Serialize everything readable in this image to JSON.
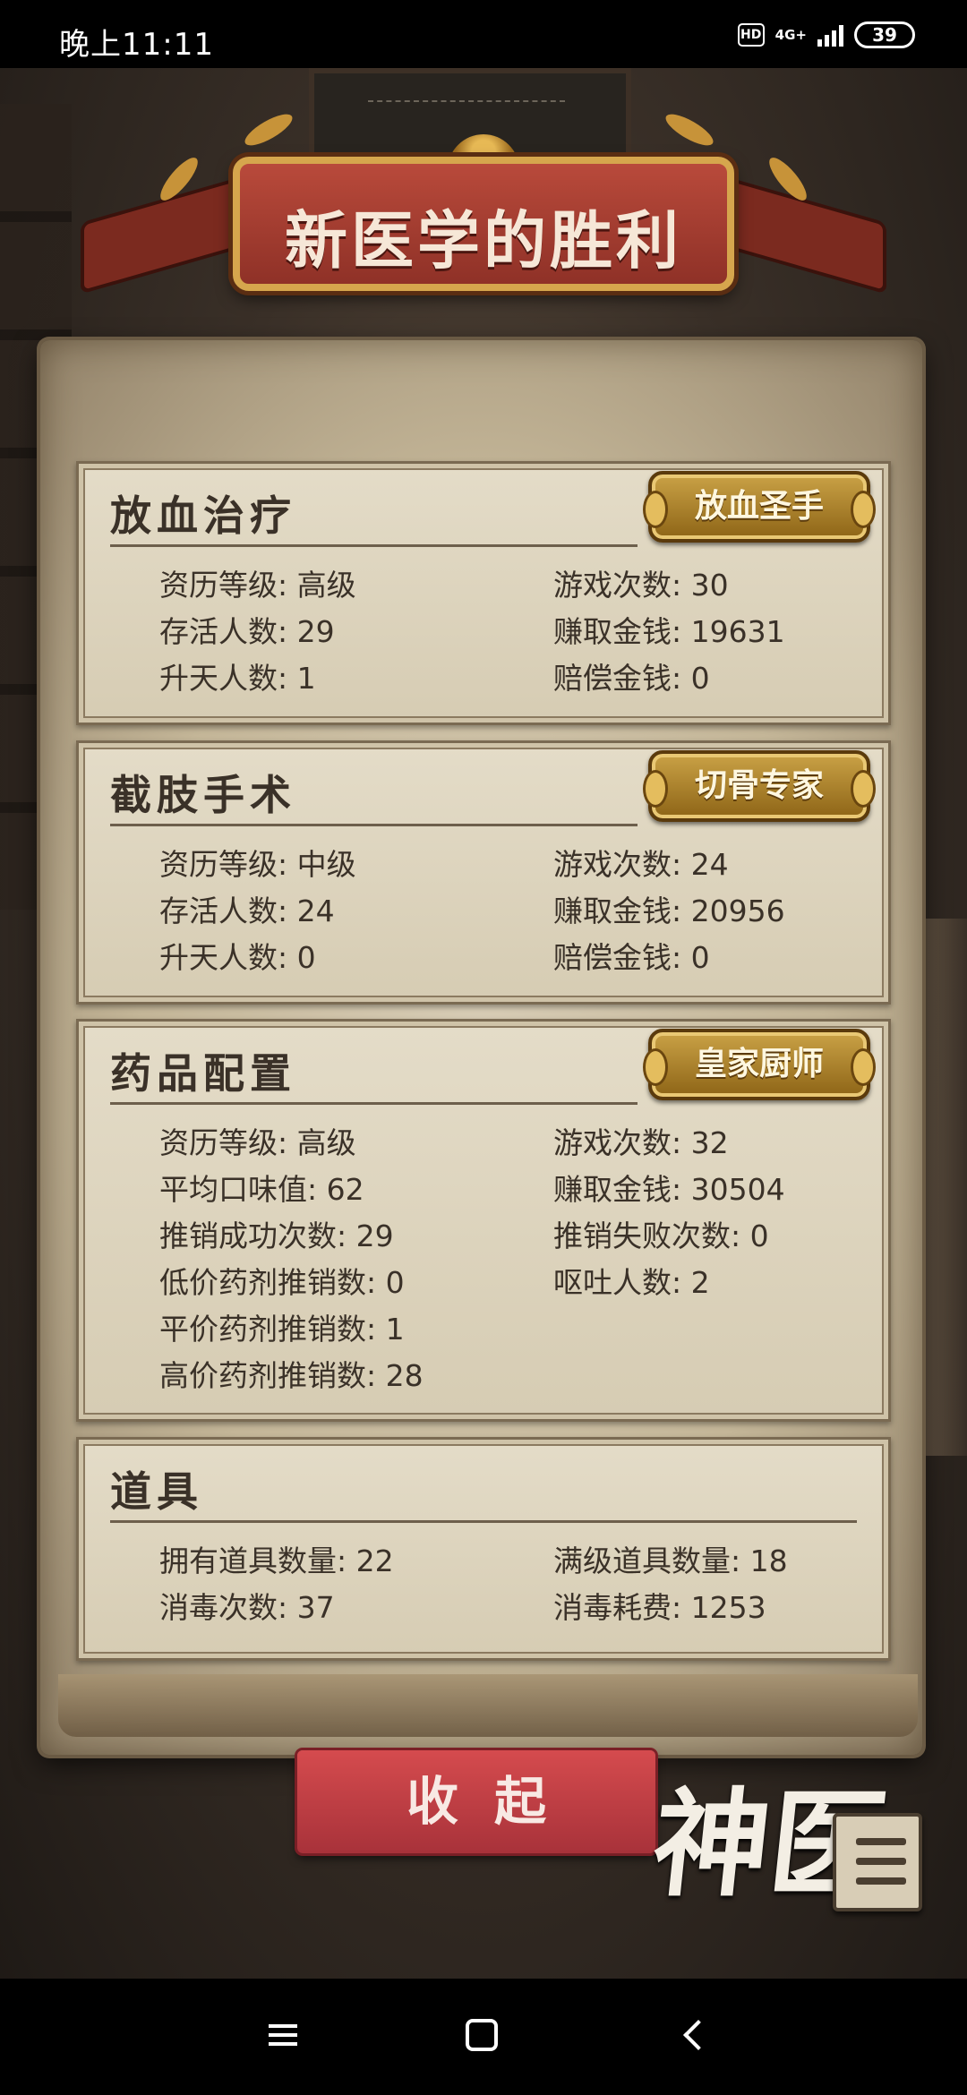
{
  "status_bar": {
    "time": "晚上11:11",
    "hd": "HD",
    "network": "4G+",
    "battery": "39"
  },
  "banner": {
    "title": "新医学的胜利"
  },
  "sections": [
    {
      "title": "放血治疗",
      "badge": "放血圣手",
      "stats": [
        {
          "label": "资历等级",
          "value": "高级"
        },
        {
          "label": "游戏次数",
          "value": "30"
        },
        {
          "label": "存活人数",
          "value": "29"
        },
        {
          "label": "赚取金钱",
          "value": "19631"
        },
        {
          "label": "升天人数",
          "value": "1"
        },
        {
          "label": "赔偿金钱",
          "value": "0"
        }
      ]
    },
    {
      "title": "截肢手术",
      "badge": "切骨专家",
      "stats": [
        {
          "label": "资历等级",
          "value": "中级"
        },
        {
          "label": "游戏次数",
          "value": "24"
        },
        {
          "label": "存活人数",
          "value": "24"
        },
        {
          "label": "赚取金钱",
          "value": "20956"
        },
        {
          "label": "升天人数",
          "value": "0"
        },
        {
          "label": "赔偿金钱",
          "value": "0"
        }
      ]
    },
    {
      "title": "药品配置",
      "badge": "皇家厨师",
      "stats": [
        {
          "label": "资历等级",
          "value": "高级"
        },
        {
          "label": "游戏次数",
          "value": "32"
        },
        {
          "label": "平均口味值",
          "value": "62"
        },
        {
          "label": "赚取金钱",
          "value": "30504"
        },
        {
          "label": "推销成功次数",
          "value": "29"
        },
        {
          "label": "推销失败次数",
          "value": "0"
        },
        {
          "label": "低价药剂推销数",
          "value": "0"
        },
        {
          "label": "呕吐人数",
          "value": "2"
        },
        {
          "label": "平价药剂推销数",
          "value": "1"
        },
        {
          "label": "",
          "value": ""
        },
        {
          "label": "高价药剂推销数",
          "value": "28"
        }
      ]
    },
    {
      "title": "道具",
      "badge": "",
      "stats": [
        {
          "label": "拥有道具数量",
          "value": "22"
        },
        {
          "label": "满级道具数量",
          "value": "18"
        },
        {
          "label": "消毒次数",
          "value": "37"
        },
        {
          "label": "消毒耗费",
          "value": "1253"
        }
      ]
    }
  ],
  "collapse_button": {
    "label": "收起"
  },
  "logo": {
    "text": "神医"
  },
  "colors": {
    "banner": "#a83c30",
    "badge_gold": "#b8902f",
    "button_red": "#c8414a",
    "parchment": "#d8cdb6"
  }
}
